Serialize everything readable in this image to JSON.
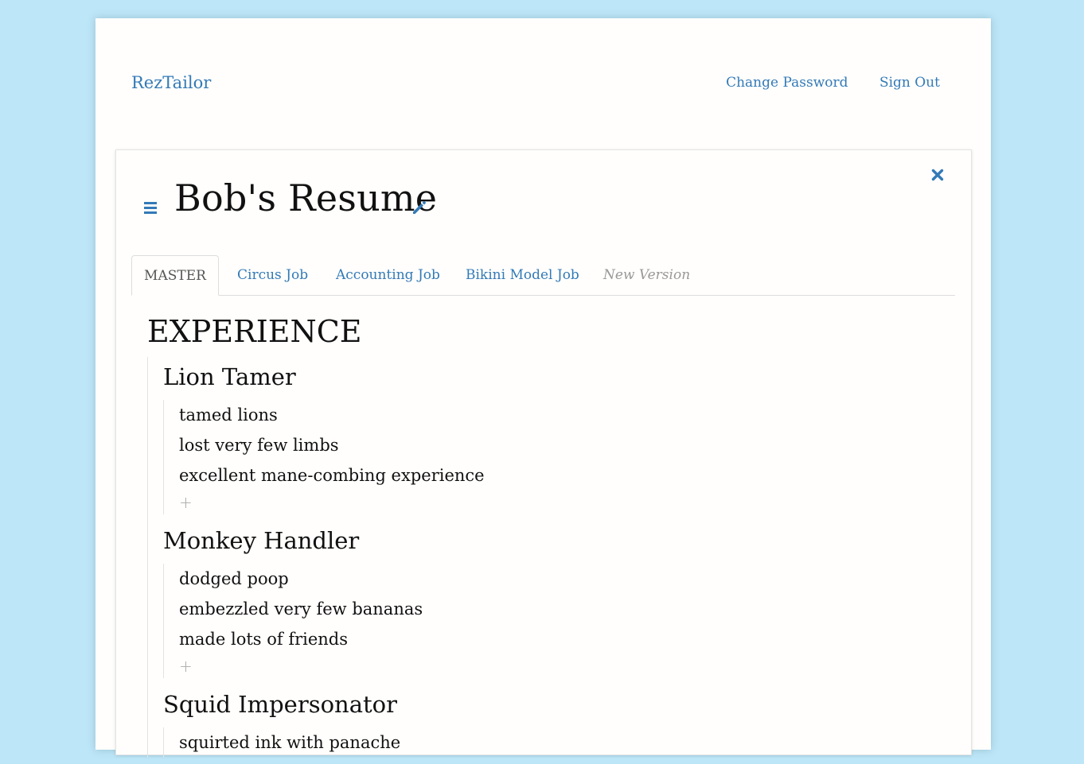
{
  "navbar": {
    "brand": "RezTailor",
    "links": [
      "Change Password",
      "Sign Out"
    ]
  },
  "resume": {
    "title": "Bob's Resume"
  },
  "tabs": [
    {
      "label": "MASTER",
      "active": true
    },
    {
      "label": "Circus Job",
      "active": false
    },
    {
      "label": "Accounting Job",
      "active": false
    },
    {
      "label": "Bikini Model Job",
      "active": false
    },
    {
      "label": "New Version",
      "active": false
    }
  ],
  "section": {
    "title": "EXPERIENCE",
    "add_label": "+",
    "jobs": [
      {
        "title": "Lion Tamer",
        "bullets": [
          "tamed lions",
          "lost very few limbs",
          "excellent mane-combing experience"
        ]
      },
      {
        "title": "Monkey Handler",
        "bullets": [
          "dodged poop",
          "embezzled very few bananas",
          "made lots of friends"
        ]
      },
      {
        "title": "Squid Impersonator",
        "bullets": [
          "squirted ink with panache"
        ]
      }
    ]
  },
  "icons": {
    "menu": "menu-icon",
    "edit": "pencil-icon",
    "close": "close-icon"
  },
  "colors": {
    "page_background": "#bde7f8",
    "link": "#337ab7",
    "muted": "#999999"
  }
}
